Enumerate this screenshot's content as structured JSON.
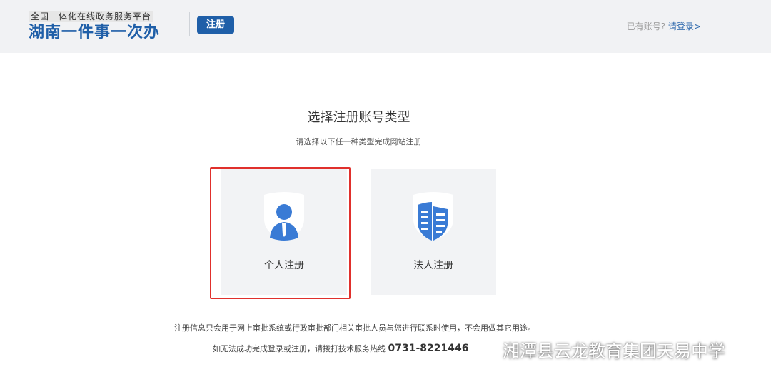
{
  "header": {
    "logo_sub": "全国一体化在线政务服务平台",
    "logo_main": "湖南一件事一次办",
    "badge": "注册",
    "login_prompt": "已有账号?",
    "login_link": "请登录>"
  },
  "main": {
    "title": "选择注册账号类型",
    "subtitle": "请选择以下任一种类型完成网站注册",
    "cards": [
      {
        "label": "个人注册",
        "icon": "person-shield-icon",
        "selected": true
      },
      {
        "label": "法人注册",
        "icon": "building-shield-icon",
        "selected": false
      }
    ]
  },
  "footer": {
    "note": "注册信息只会用于网上审批系统或行政审批部门相关审批人员与您进行联系时使用，不会用做其它用途。",
    "hotline_text": "如无法成功完成登录或注册，请拨打技术服务热线",
    "hotline_number": "0731-8221446"
  },
  "watermark": {
    "text": "湘潭县云龙教育集团天易中学"
  },
  "colors": {
    "brand_blue": "#1f5fa8",
    "icon_blue": "#3a7bd5",
    "highlight_red": "#e0302c"
  }
}
